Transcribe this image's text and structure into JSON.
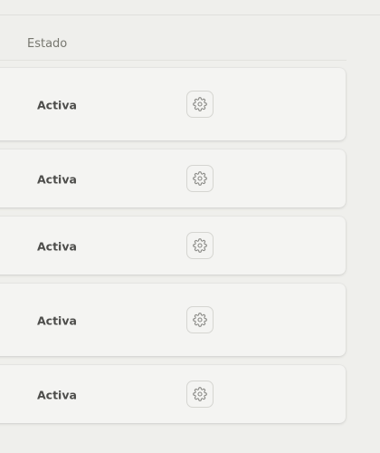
{
  "table": {
    "column_header": "Estado"
  },
  "rows": [
    {
      "status": "Activa",
      "action_icon": "gear-icon"
    },
    {
      "status": "Activa",
      "action_icon": "gear-icon"
    },
    {
      "status": "Activa",
      "action_icon": "gear-icon"
    },
    {
      "status": "Activa",
      "action_icon": "gear-icon"
    },
    {
      "status": "Activa",
      "action_icon": "gear-icon"
    }
  ]
}
